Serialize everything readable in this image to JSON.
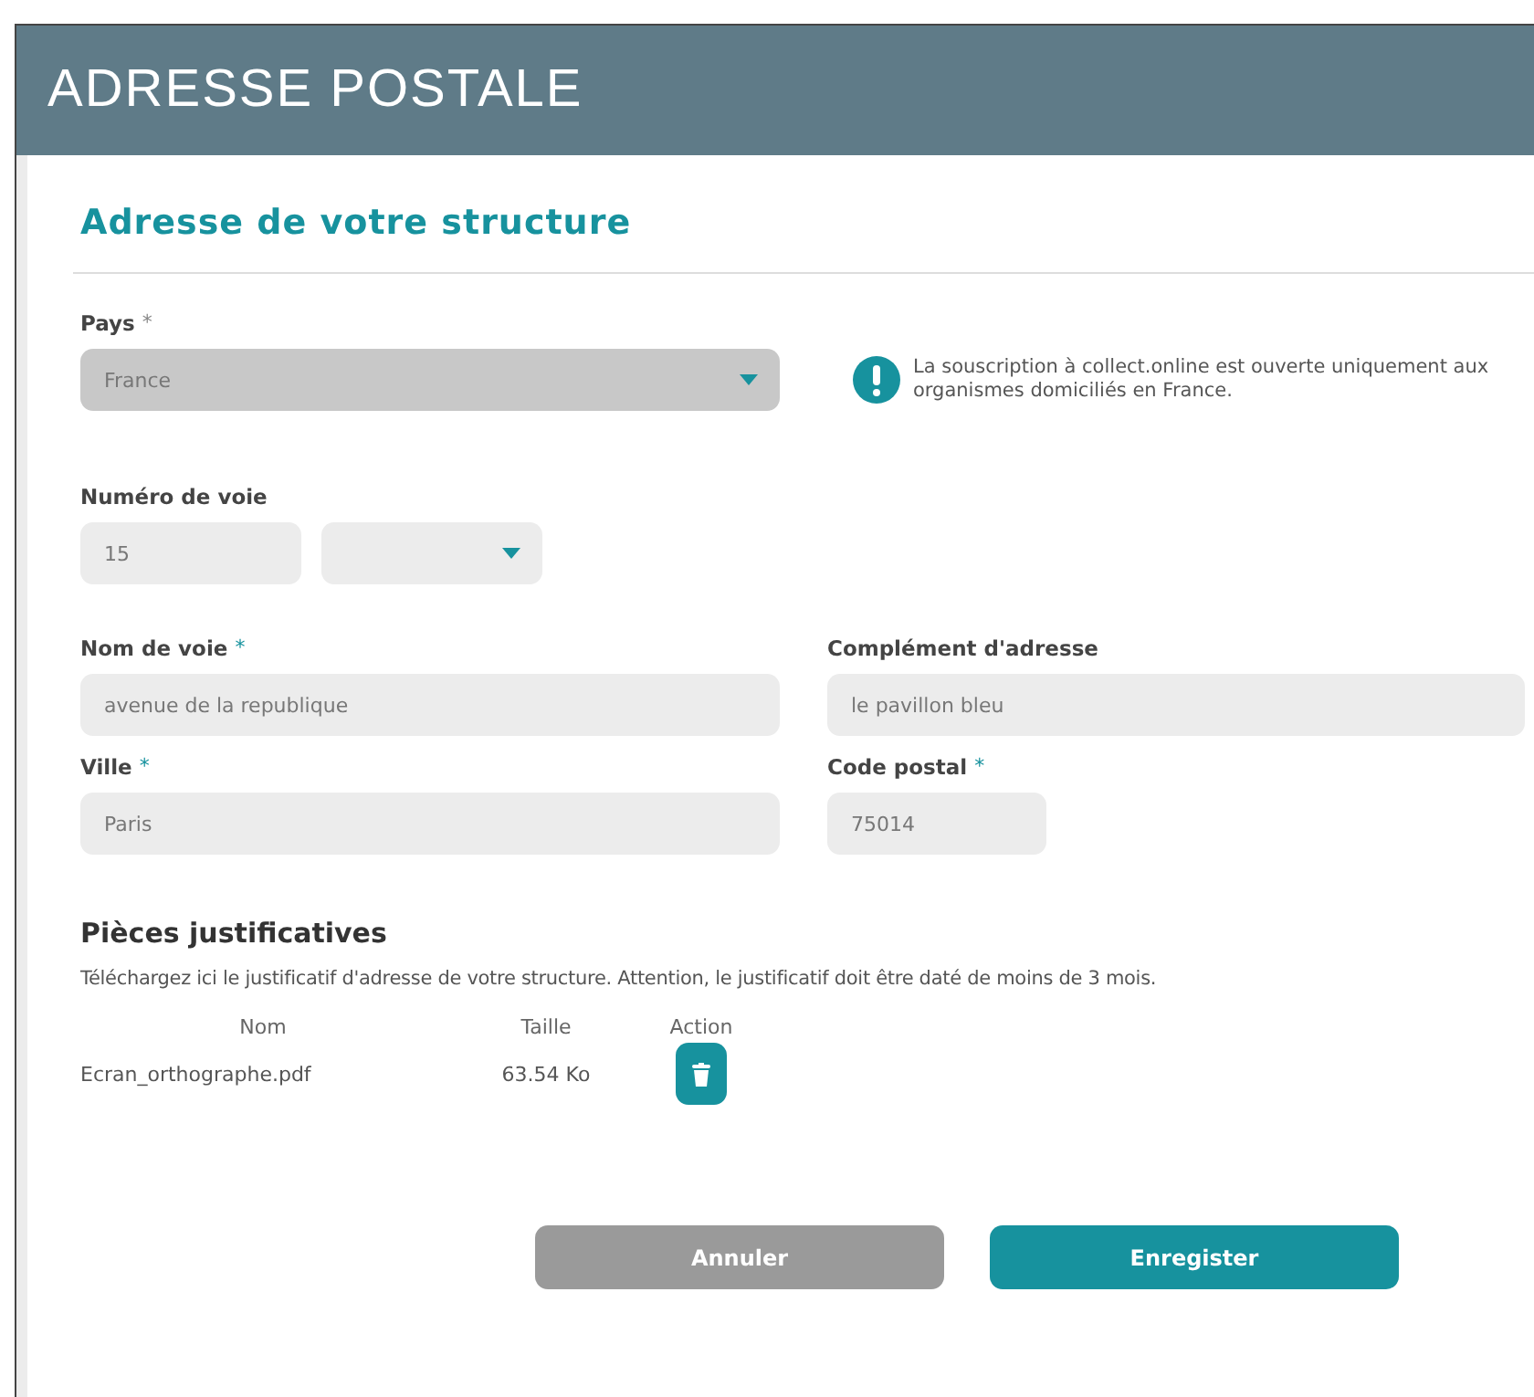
{
  "header": {
    "title": "ADRESSE POSTALE"
  },
  "section_title": "Adresse de votre structure",
  "country": {
    "label": "Pays",
    "asterisk": "*",
    "disabled": true,
    "value": "France"
  },
  "notice": "La souscription à collect.online est ouverte uniquement aux organismes domiciliés en France.",
  "street_number": {
    "label": "Numéro de voie",
    "value": "15"
  },
  "rows": [
    {
      "left": {
        "label": "Nom de voie",
        "asterisk": "*",
        "value": "avenue de la republique"
      },
      "right": {
        "label": "Complément d'adresse",
        "value": "le pavillon bleu"
      }
    },
    {
      "left": {
        "label": "Ville",
        "asterisk": "*",
        "value": "Paris"
      },
      "right": {
        "label": "Code postal",
        "asterisk": "*",
        "value": "75014"
      }
    }
  ],
  "documents": {
    "title": "Pièces justificatives",
    "description": "Téléchargez ici le justificatif d'adresse de votre structure. Attention, le justificatif doit être daté de moins de 3 mois.",
    "columns": [
      "Nom",
      "Taille",
      "Action"
    ],
    "files": [
      {
        "name": "Ecran_orthographe.pdf",
        "size": "63.54 Ko"
      }
    ]
  },
  "buttons": [
    {
      "label": "Annuler",
      "kind": "secondary"
    },
    {
      "label": "Enregister",
      "kind": "primary"
    }
  ]
}
